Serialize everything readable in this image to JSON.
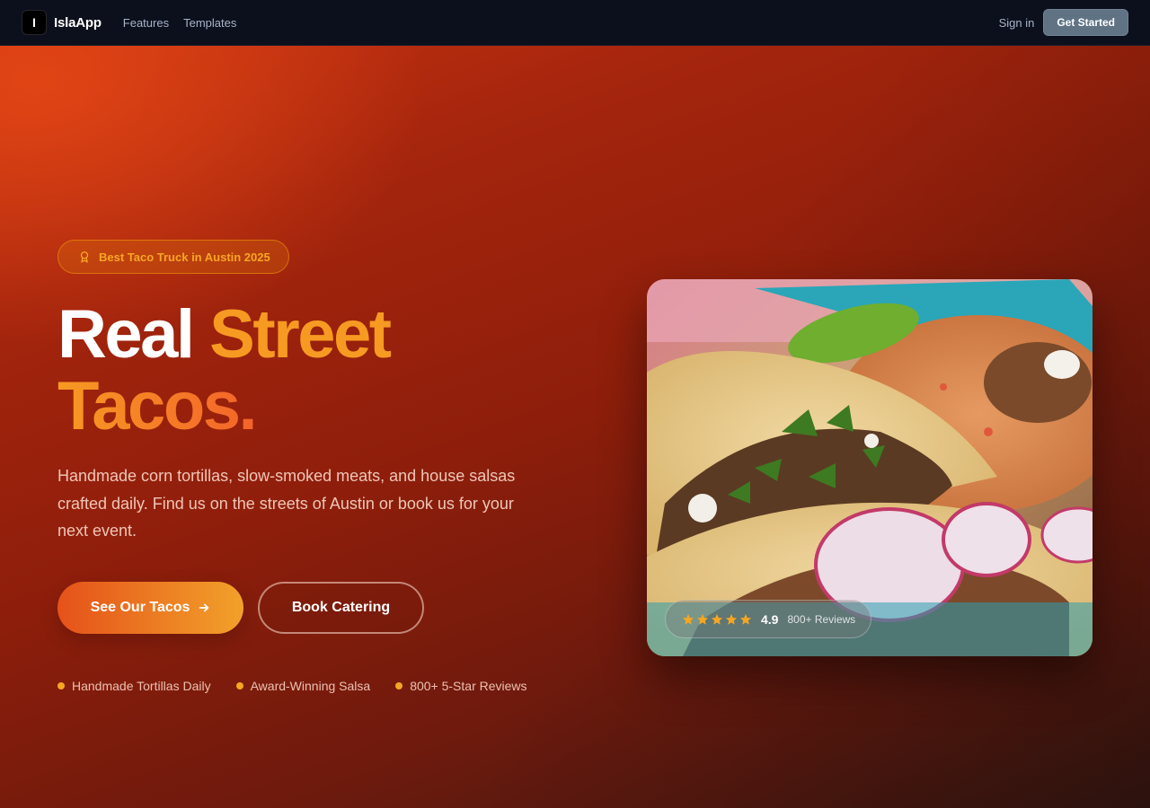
{
  "nav": {
    "logo_letter": "I",
    "brand": "IslaApp",
    "links": [
      "Features",
      "Templates"
    ],
    "sign_in": "Sign in",
    "cta": "Get Started"
  },
  "hero": {
    "badge": {
      "icon": "award-icon",
      "label": "Best Taco Truck in Austin 2025"
    },
    "headline": {
      "white": "Real",
      "orange": "Street",
      "orange2": "Tacos."
    },
    "description": "Handmade corn tortillas, slow-smoked meats, and house salsas crafted daily. Find us on the streets of Austin or book us for your next event.",
    "primary_button": {
      "label": "See Our Tacos",
      "icon": "arrow-right-icon"
    },
    "secondary_button": {
      "label": "Book Catering"
    },
    "features": [
      "Handmade Tortillas Daily",
      "Award-Winning Salsa",
      "800+ 5-Star Reviews"
    ]
  },
  "card": {
    "image": "tacos-photo",
    "rating": {
      "stars": 5,
      "value": "4.9",
      "count": "800+ Reviews"
    }
  },
  "colors": {
    "accent_orange": "#f79a22",
    "hero_red": "#a5250d",
    "nav_bg": "#0c101c",
    "cta_bg": "#5f7385"
  }
}
